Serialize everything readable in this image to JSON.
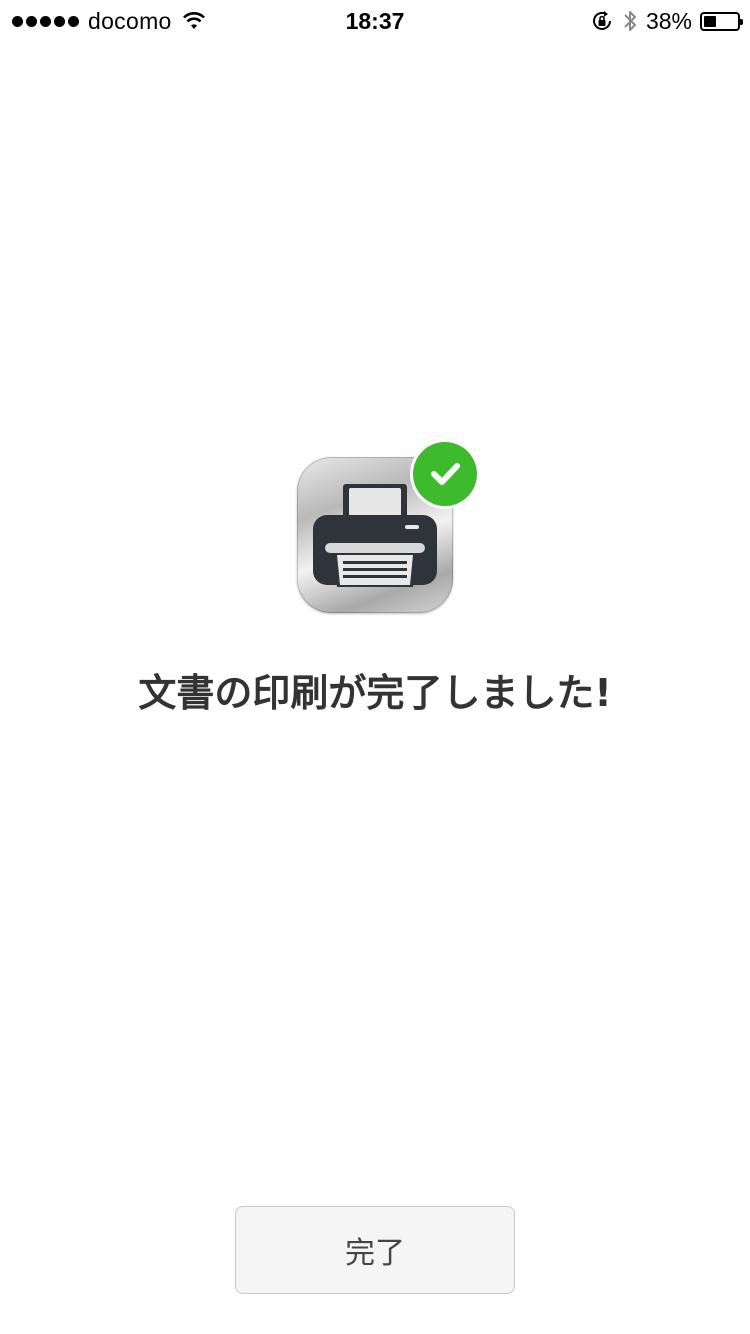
{
  "status_bar": {
    "carrier": "docomo",
    "time": "18:37",
    "battery_percent_label": "38%",
    "battery_level": 0.38,
    "icons": [
      "signal-dots-icon",
      "wifi-icon",
      "rotation-lock-icon",
      "bluetooth-icon",
      "battery-icon"
    ]
  },
  "main": {
    "app_icon": "printer-app-icon",
    "badge_icon": "check-icon",
    "badge_color": "#3dbb2c",
    "message": "文書の印刷が完了しました!"
  },
  "footer": {
    "done_label": "完了"
  }
}
